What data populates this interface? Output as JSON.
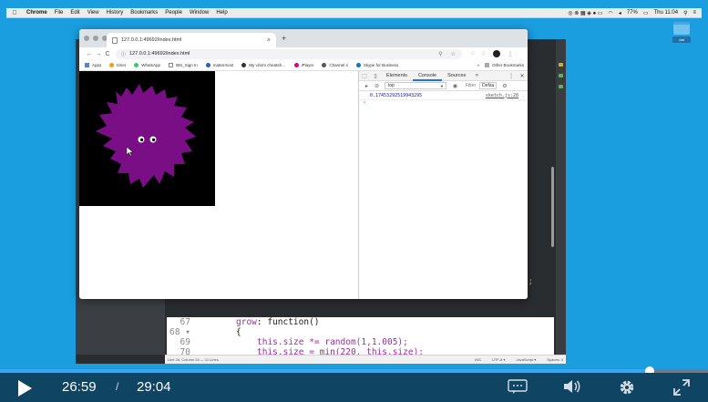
{
  "menubar": {
    "apple_icon": "apple-icon",
    "items": [
      "Chrome",
      "File",
      "Edit",
      "View",
      "History",
      "Bookmarks",
      "People",
      "Window",
      "Help"
    ],
    "battery": "77%",
    "clock": "Thu 11:04"
  },
  "desktop": {
    "icon_label": "dat"
  },
  "chrome": {
    "tab_title": "127.0.0.1:49692/index.html",
    "url": "127.0.0.1:49692/index.html",
    "bookmarks": [
      "Apps",
      "timer",
      "WhatsApp",
      "IBS_Sign In",
      "mattermost",
      "My vi/vim cheatsh…",
      "iPlayer",
      "Channel 4",
      "Skype for Business"
    ],
    "bookmarks_more": "»",
    "other_bookmarks": "Other Bookmarks"
  },
  "devtools": {
    "tabs": [
      "Elements",
      "Console",
      "Sources"
    ],
    "active_tab": "Console",
    "context": "top",
    "filter_placeholder": "Filter",
    "level": "Defau",
    "log_value": "0.17453292519943295",
    "log_source": "sketch.js:28",
    "prompt": "›"
  },
  "editor": {
    "lines": [
      {
        "num": "67",
        "text_kw": "grow",
        "text_rest": ": function()"
      },
      {
        "num": "68 ▾",
        "text_kw": "",
        "text_rest": "{"
      },
      {
        "num": "69",
        "text_kw": "",
        "text_rest": "this.size *= random(1,1.005);"
      },
      {
        "num": "70",
        "text_kw": "",
        "text_rest": "this.size = min(220, this.size);"
      }
    ],
    "semicolon": ";",
    "status_left": "Line 34, Column 34 — 11 Lines",
    "status_ins": "INS",
    "status_enc": "UTF-8 ▾",
    "status_lang": "JavaScript ▾",
    "status_spaces": "Spaces: 4"
  },
  "player": {
    "current_time": "26:59",
    "separator": "/",
    "duration": "29:04",
    "progress_fraction": 0.918,
    "icons": [
      "play-icon",
      "captions-icon",
      "volume-icon",
      "settings-icon",
      "fullscreen-icon"
    ]
  },
  "colors": {
    "desktop": "#1a9ee0",
    "player_bar": "#0f4463",
    "progress": "#3ea6f0",
    "blob": "#7a0f85"
  }
}
